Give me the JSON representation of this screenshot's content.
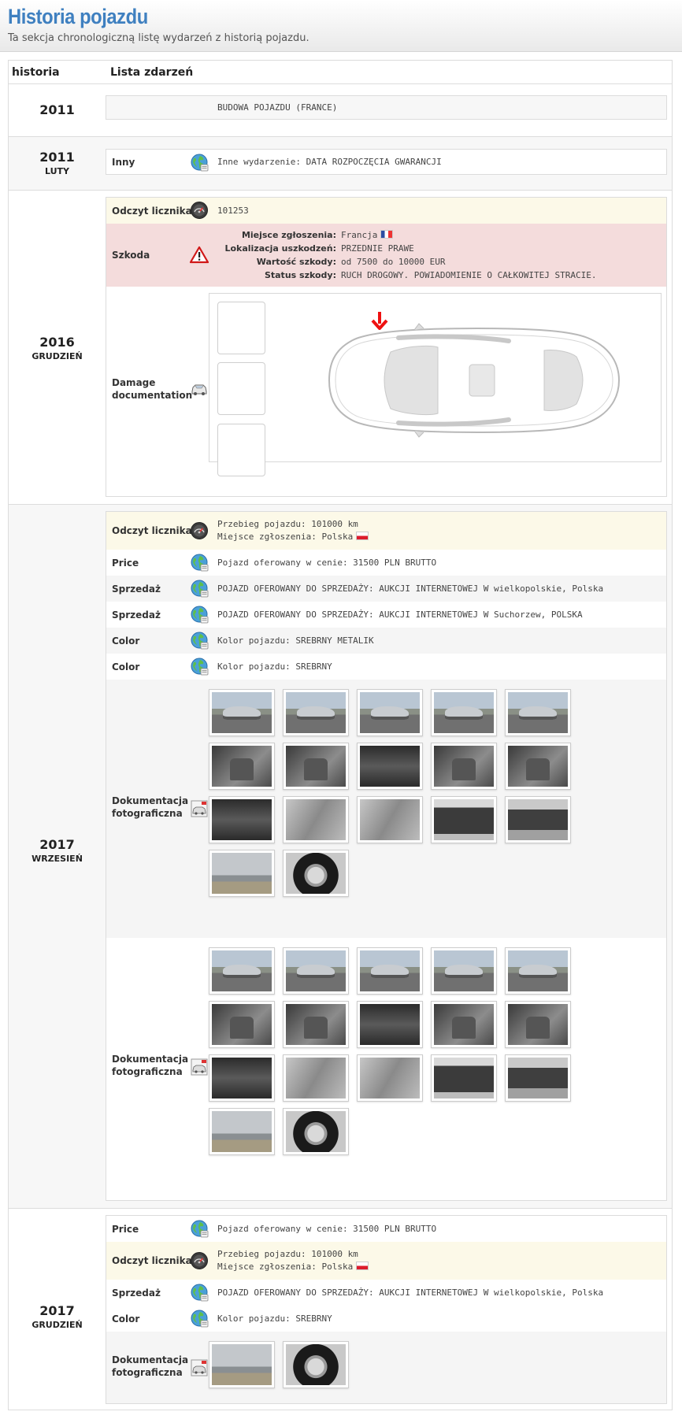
{
  "header": {
    "title": "Historia pojazdu",
    "subtitle": "Ta sekcja chronologiczną listę wydarzeń z historią pojazdu."
  },
  "table": {
    "col_history": "historia",
    "col_events": "Lista zdarzeń"
  },
  "sections": [
    {
      "year": "2011",
      "month": "",
      "rows": [
        {
          "label": "",
          "icon": "",
          "value": "BUDOWA POJAZDU (FRANCE)"
        }
      ]
    },
    {
      "year": "2011",
      "month": "LUTY",
      "rows": [
        {
          "label": "Inny",
          "icon": "globe-icon",
          "value": "Inne wydarzenie: DATA ROZPOCZĘCIA GWARANCJI"
        }
      ]
    },
    {
      "year": "2016",
      "month": "GRUDZIEŃ",
      "odometer": {
        "label": "Odczyt licznika",
        "icon": "odometer-icon",
        "value": "101253"
      },
      "damage": {
        "label": "Szkoda",
        "icon": "warning-icon",
        "fields": [
          {
            "k": "Miejsce zgłoszenia:",
            "v": "Francja",
            "flag": "fr"
          },
          {
            "k": "Lokalizacja uszkodzeń:",
            "v": "PRZEDNIE PRAWE"
          },
          {
            "k": "Wartość szkody:",
            "v": "od 7500 do 10000 EUR"
          },
          {
            "k": "Status szkody:",
            "v": "RUCH DROGOWY. POWIADOMIENIE O CAŁKOWITEJ STRACIE."
          }
        ]
      },
      "damage_doc": {
        "label": "Damage documentation",
        "icon": "car-icon"
      }
    },
    {
      "year": "2017",
      "month": "WRZESIEŃ",
      "odometer": {
        "label": "Odczyt licznika",
        "icon": "odometer-icon",
        "line1": "Przebieg pojazdu: 101000 km",
        "line2": "Miejsce zgłoszenia: Polska",
        "flag": "pl"
      },
      "rows": [
        {
          "label": "Price",
          "icon": "globe-icon",
          "value": "Pojazd oferowany w cenie: 31500 PLN BRUTTO"
        },
        {
          "label": "Sprzedaż",
          "icon": "globe-icon",
          "value": "POJAZD OFEROWANY DO SPRZEDAŻY: AUKCJI INTERNETOWEJ W wielkopolskie, Polska"
        },
        {
          "label": "Sprzedaż",
          "icon": "globe-icon",
          "value": "POJAZD OFEROWANY DO SPRZEDAŻY: AUKCJI INTERNETOWEJ W Suchorzew, POLSKA"
        },
        {
          "label": "Color",
          "icon": "globe-icon",
          "value": "Kolor pojazdu: SREBRNY METALIK"
        },
        {
          "label": "Color",
          "icon": "globe-icon",
          "value": "Kolor pojazdu: SREBRNY"
        }
      ],
      "photos1": {
        "label": "Dokumentacja fotograficzna",
        "icon": "photo-doc-icon"
      },
      "photos2": {
        "label": "Dokumentacja fotograficzna",
        "icon": "photo-doc-icon"
      }
    },
    {
      "year": "2017",
      "month": "GRUDZIEŃ",
      "rows": [
        {
          "label": "Price",
          "icon": "globe-icon",
          "value": "Pojazd oferowany w cenie: 31500 PLN BRUTTO"
        },
        {
          "label": "Sprzedaż",
          "icon": "globe-icon",
          "value": "POJAZD OFEROWANY DO SPRZEDAŻY: AUKCJI INTERNETOWEJ W wielkopolskie, Polska"
        },
        {
          "label": "Color",
          "icon": "globe-icon",
          "value": "Kolor pojazdu: SREBRNY"
        }
      ],
      "odometer": {
        "label": "Odczyt licznika",
        "icon": "odometer-icon",
        "line1": "Przebieg pojazdu: 101000 km",
        "line2": "Miejsce zgłoszenia: Polska",
        "flag": "pl"
      },
      "photos": {
        "label": "Dokumentacja fotograficzna",
        "icon": "photo-doc-icon"
      }
    }
  ]
}
